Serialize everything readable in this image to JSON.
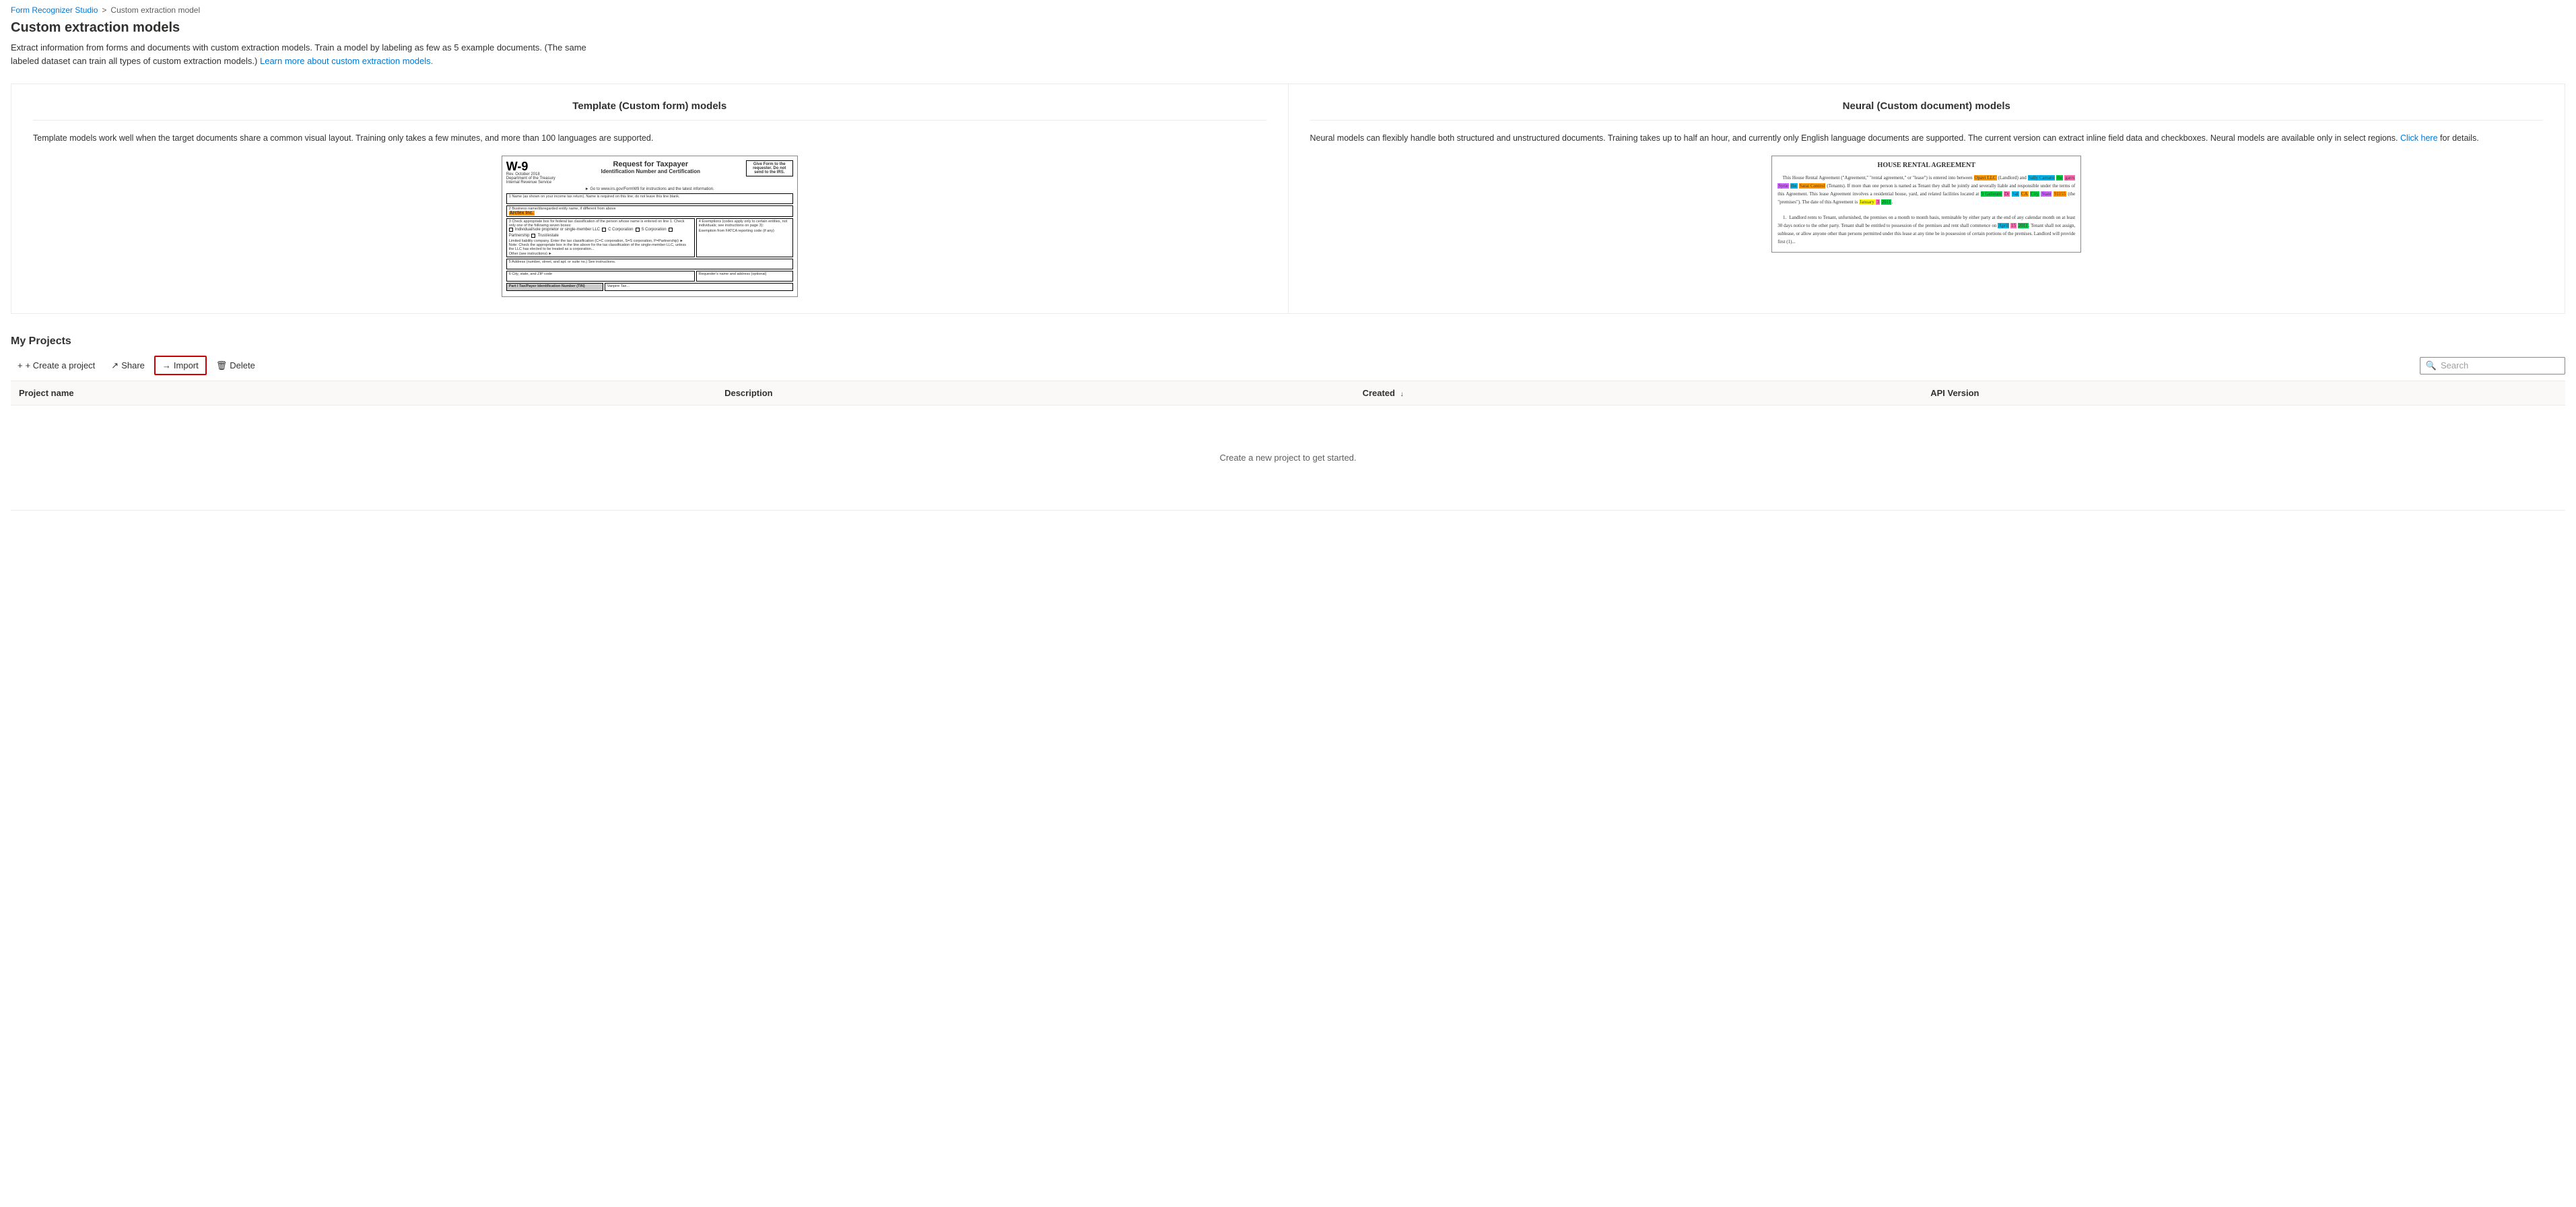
{
  "breadcrumb": {
    "studio_label": "Form Recognizer Studio",
    "separator": ">",
    "current": "Custom extraction model"
  },
  "page": {
    "title": "Custom extraction models",
    "description": "Extract information from forms and documents with custom extraction models. Train a model by labeling as few as 5 example documents. (The same labeled dataset can train all types of custom extraction models.)",
    "learn_more_text": "Learn more about custom extraction models.",
    "learn_more_href": "#"
  },
  "model_cards": [
    {
      "id": "template",
      "title": "Template (Custom form) models",
      "description": "Template models work well when the target documents share a common visual layout. Training only takes a few minutes, and more than 100 languages are supported."
    },
    {
      "id": "neural",
      "title": "Neural (Custom document) models",
      "description": "Neural models can flexibly handle both structured and unstructured documents. Training takes up to half an hour, and currently only English language documents are supported. The current version can extract inline field data and checkboxes. Neural models are available only in select regions.",
      "click_here_text": "Click here",
      "for_details": "for details."
    }
  ],
  "w9_form": {
    "form_number": "W-9",
    "form_sub": "Rev. October 2018",
    "dept": "Department of the Treasury",
    "irs": "Internal Revenue Service",
    "title": "Request for Taxpayer",
    "subtitle": "Identification Number and Certification",
    "give_form": "Give Form to the requester. Do not send to the IRS.",
    "instruction": "► Go to www.irs.gov/FormW9 for instructions and the latest information.",
    "field1_label": "1 Name (as shown on your income tax return). Name is required on this line; do not leave this line blank.",
    "field1_value": "",
    "field2_label": "2 Business name/disregarded entity name, if different from above",
    "field_value_highlighted": "Arctex Inc.",
    "field3_label": "3 Check appropriate box for federal tax classification of the person whose name is entered on line 1:",
    "checkbox_options": [
      "Individual/sole proprietor or single-member LLC",
      "C Corporation",
      "S Corporation",
      "Partnership",
      "Trust/estate"
    ],
    "field4_label": "4 Exemptions (codes apply only to certain entities, not individuals; see instructions on page 3):",
    "llc_label": "Limited liability company. Enter the tax classification (C=C corporation, S=S corporation, P=Partnership) ►",
    "other_label": "Other (see instructions) ►",
    "address_label": "5 Address (number, street, and apt. or suite no.) See instructions."
  },
  "rental_agreement": {
    "title": "HOUSE RENTAL AGREEMENT",
    "paragraph1": "This House Rental Agreement (\"Agreement,\" \"rental agreement,\" or \"lease\") is entered into between",
    "landlord": "Opavi LLC",
    "landlord_suffix": "(Landlord) and",
    "tenants": "Sally Camaro",
    "tenants2": "the",
    "party3": "garrs",
    "party4": "Syrie",
    "party5": "the",
    "party6": "Sarai Control",
    "tenant_suffix": "(Tenants). If more than one person is named as Tenant they shall be jointly and severally liable and responsible under the terms of this Agreement. This lease Agreement involves a residential house, yard, and related facilities located at",
    "address_parts": [
      "9 Gelieure",
      "Dr",
      "Sal",
      "CA",
      "City",
      "State",
      "91155"
    ],
    "premises_suffix": "(the \"premises\"). The date of this Agreement is",
    "date_month": "January",
    "date_day": "3",
    "date_year": "2011",
    "para2_title": "1.",
    "para2": "Landlord rents to Tenant, unfurnished, the premises on a month to month basis, terminable by either party at the end of any calendar month on at least 30 days notice to the other party. Tenant shall be entitled to possession of the premises and rent shall commence on",
    "commence_date": "April",
    "commence_day": "15",
    "commence_year": "2011",
    "para2_cont": "Tenant shall not assign, sublease, or allow anyone other than persons permitted under this"
  },
  "projects": {
    "section_title": "My Projects",
    "toolbar": {
      "create_label": "+ Create a project",
      "share_label": "Share",
      "import_label": "Import",
      "delete_label": "Delete"
    },
    "search": {
      "placeholder": "Search"
    },
    "table": {
      "columns": [
        {
          "id": "name",
          "label": "Project name",
          "sortable": false
        },
        {
          "id": "description",
          "label": "Description",
          "sortable": false
        },
        {
          "id": "created",
          "label": "Created",
          "sortable": true,
          "sort_icon": "↓"
        },
        {
          "id": "api_version",
          "label": "API Version",
          "sortable": false
        }
      ],
      "rows": [],
      "empty_state": "Create a new project to get started."
    }
  },
  "icons": {
    "search": "🔍",
    "share": "↗",
    "import": "→",
    "delete": "🗑",
    "plus": "+",
    "sort_desc": "↓"
  }
}
